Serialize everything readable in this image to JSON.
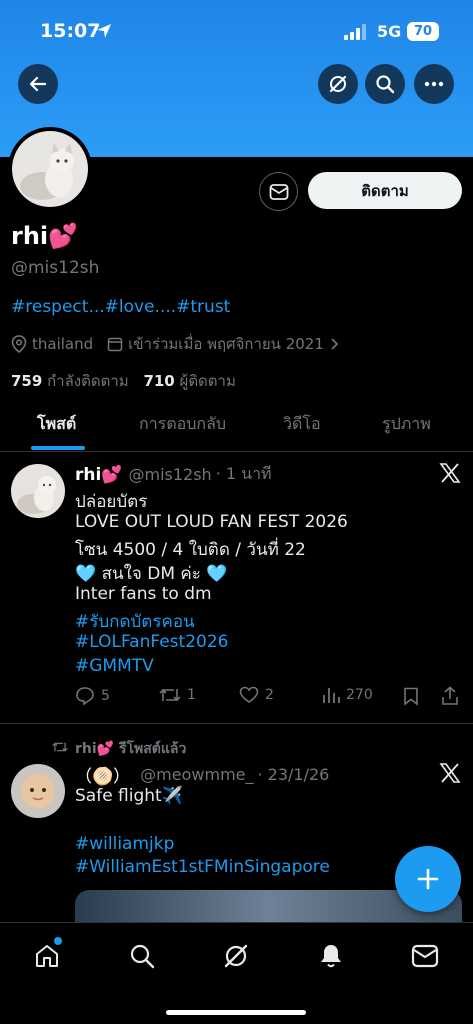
{
  "status_bar": {
    "time": "15:07",
    "network": "5G",
    "battery": "70"
  },
  "profile": {
    "name": "rhi💕",
    "handle": "@mis12sh",
    "bio": "#respect...#love....#trust",
    "location": "thailand",
    "joined": "เข้าร่วมเมื่อ พฤศจิกายน 2021",
    "following_count": "759",
    "following_label": "กำลังติดตาม",
    "followers_count": "710",
    "followers_label": "ผู้ติดตาม",
    "follow_button": "ติดตาม"
  },
  "tabs": [
    {
      "label": "โพสต์"
    },
    {
      "label": "การตอบกลับ"
    },
    {
      "label": "วิดีโอ"
    },
    {
      "label": "รูปภาพ"
    }
  ],
  "post1": {
    "name": "rhi💕",
    "handle": "@mis12sh",
    "time": "· 1 นาที",
    "lines": [
      "ปล่อยบัตร",
      "LOVE OUT LOUD FAN FEST 2026",
      "โซน 4500 / 4 ใบติด / วันที่ 22",
      "🩵 สนใจ DM ค่ะ 🩵",
      "Inter fans to dm"
    ],
    "hashtags": [
      "#รับกดบัตรคอน",
      "#LOLFanFest2026",
      "#GMMTV"
    ],
    "replies": "5",
    "reposts": "1",
    "likes": "2",
    "views": "270"
  },
  "post2": {
    "repost_label": "rhi💕 รีโพสต์แล้ว",
    "name": "（🫓）",
    "handle": "@meowmme_",
    "time": "· 23/1/26",
    "text": "Safe flight✈️",
    "hashtags": [
      "#williamjkp",
      "#WilliamEst1stFMinSingapore"
    ]
  },
  "colors": {
    "accent": "#1d9bf0",
    "header": "#1f86e8"
  }
}
